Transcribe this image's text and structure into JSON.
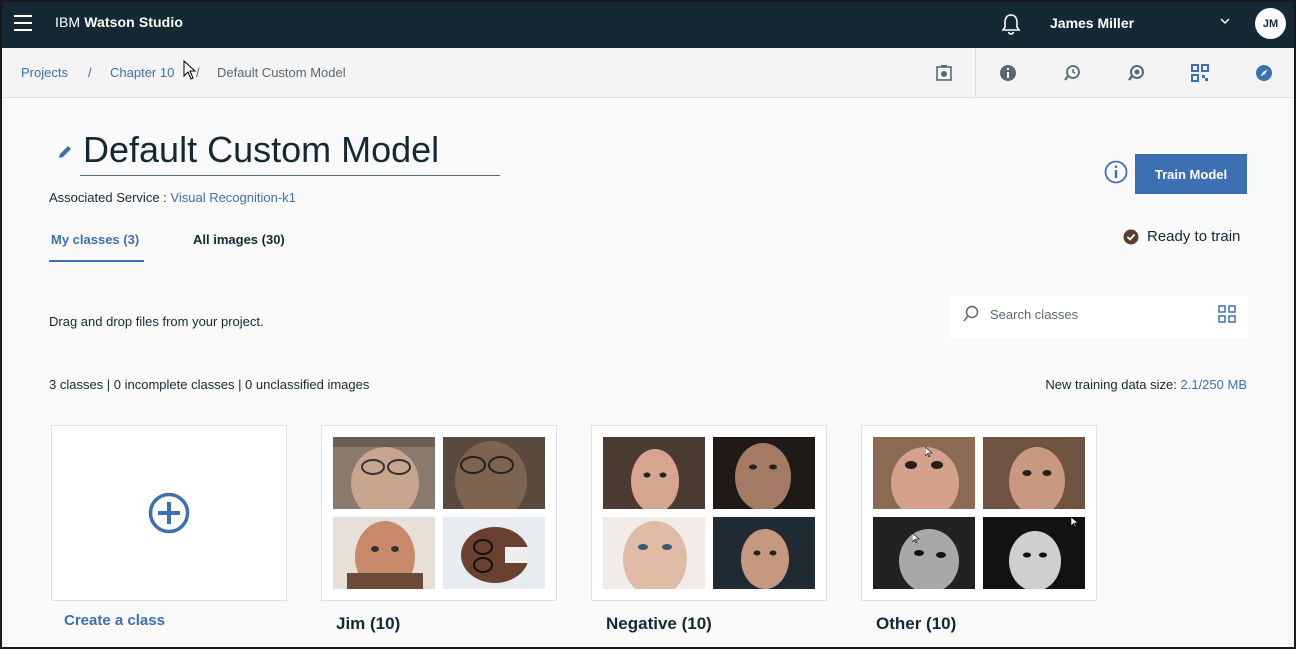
{
  "app": {
    "title_prefix": "IBM",
    "title_main": "Watson Studio",
    "user_name": "James Miller",
    "avatar_initials": "JM"
  },
  "breadcrumb": {
    "items": [
      {
        "label": "Projects"
      },
      {
        "label": "Chapter 10"
      }
    ],
    "separator": "/",
    "current": "Default Custom Model"
  },
  "toolbar": {
    "icons": [
      "camera-icon",
      "info-circle-icon",
      "history-icon",
      "search-tool-icon",
      "qr-grid-icon",
      "compass-icon"
    ]
  },
  "model": {
    "title": "Default Custom Model",
    "associated_label": "Associated Service :",
    "associated_value": "Visual Recognition-k1",
    "train_button": "Train Model",
    "status": "Ready to train"
  },
  "tabs": [
    {
      "label": "My classes (3)",
      "active": true
    },
    {
      "label": "All images (30)",
      "active": false
    }
  ],
  "content": {
    "drag_hint": "Drag and drop files from your project.",
    "search_placeholder": "Search classes",
    "stats": "3 classes | 0 incomplete classes | 0 unclassified images",
    "size_label": "New training data size:",
    "size_value": "2.1/250 MB"
  },
  "cards": {
    "create_label": "Create a class",
    "classes": [
      {
        "label": "Jim (10)"
      },
      {
        "label": "Negative (10)"
      },
      {
        "label": "Other (10)"
      }
    ]
  },
  "colors": {
    "topbar": "#152935",
    "accent": "#3d70b2",
    "status_ok": "#5a3e2b"
  }
}
